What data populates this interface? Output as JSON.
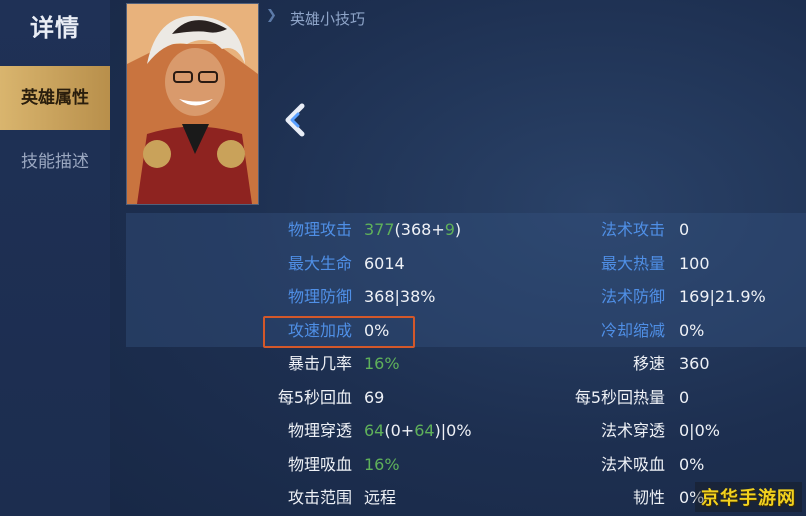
{
  "sidebar": {
    "title": "详情",
    "tabs": [
      {
        "label": "英雄属性",
        "active": true
      },
      {
        "label": "技能描述",
        "active": false
      }
    ]
  },
  "tips": {
    "label": "英雄小技巧"
  },
  "stats_left": [
    {
      "label": "物理攻击",
      "label_color": "blue",
      "parts": [
        {
          "text": "377",
          "color": "green"
        },
        {
          "text": "(368+",
          "color": "white"
        },
        {
          "text": "9",
          "color": "green"
        },
        {
          "text": ")",
          "color": "white"
        }
      ]
    },
    {
      "label": "最大生命",
      "label_color": "blue",
      "parts": [
        {
          "text": "6014",
          "color": "white"
        }
      ]
    },
    {
      "label": "物理防御",
      "label_color": "blue",
      "parts": [
        {
          "text": "368|38%",
          "color": "white"
        }
      ]
    },
    {
      "label": "攻速加成",
      "label_color": "blue",
      "parts": [
        {
          "text": "0%",
          "color": "white"
        }
      ]
    },
    {
      "label": "暴击几率",
      "label_color": "white",
      "parts": [
        {
          "text": "16%",
          "color": "green"
        }
      ]
    },
    {
      "label": "每5秒回血",
      "label_color": "white",
      "parts": [
        {
          "text": "69",
          "color": "white"
        }
      ]
    },
    {
      "label": "物理穿透",
      "label_color": "white",
      "parts": [
        {
          "text": "64",
          "color": "green"
        },
        {
          "text": "(0+",
          "color": "white"
        },
        {
          "text": "64",
          "color": "green"
        },
        {
          "text": ")|0%",
          "color": "white"
        }
      ]
    },
    {
      "label": "物理吸血",
      "label_color": "white",
      "parts": [
        {
          "text": "16%",
          "color": "green"
        }
      ]
    },
    {
      "label": "攻击范围",
      "label_color": "white",
      "parts": [
        {
          "text": "远程",
          "color": "white"
        }
      ]
    }
  ],
  "stats_right": [
    {
      "label": "法术攻击",
      "label_color": "blue",
      "value": "0"
    },
    {
      "label": "最大热量",
      "label_color": "blue",
      "value": "100"
    },
    {
      "label": "法术防御",
      "label_color": "blue",
      "value": "169|21.9%"
    },
    {
      "label": "冷却缩减",
      "label_color": "blue",
      "value": "0%"
    },
    {
      "label": "移速",
      "label_color": "white",
      "value": "360"
    },
    {
      "label": "每5秒回热量",
      "label_color": "white",
      "value": "0"
    },
    {
      "label": "法术穿透",
      "label_color": "white",
      "value": "0|0%"
    },
    {
      "label": "法术吸血",
      "label_color": "white",
      "value": "0%"
    },
    {
      "label": "韧性",
      "label_color": "white",
      "value": "0%"
    }
  ],
  "highlighted_stat": "攻速加成",
  "watermark": "京华手游网",
  "colors": {
    "accent_gold": "#d9b56e",
    "label_blue": "#4f8fe6",
    "value_green": "#5fb15a",
    "highlight": "#d3582a"
  }
}
